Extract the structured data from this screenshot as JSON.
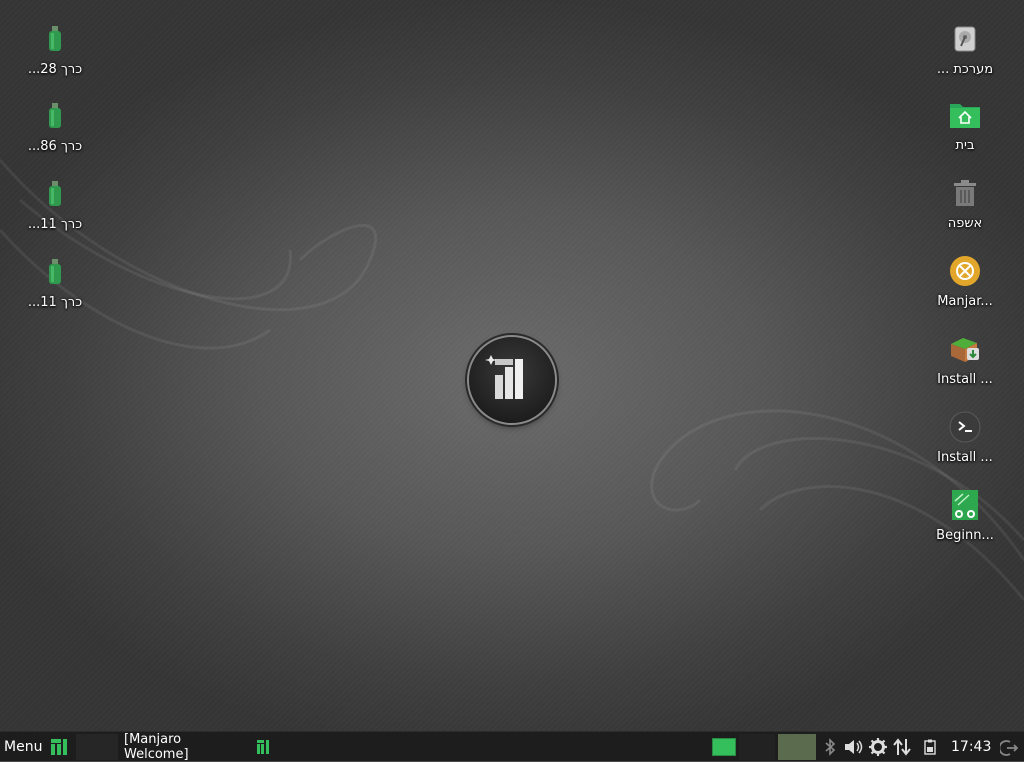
{
  "desktop": {
    "left_icons": [
      {
        "label": "כרך 28...",
        "icon": "usb-drive-icon"
      },
      {
        "label": "כרך 86...",
        "icon": "usb-drive-icon"
      },
      {
        "label": "כרך 11...",
        "icon": "usb-drive-icon"
      },
      {
        "label": "כרך 11...",
        "icon": "usb-drive-icon"
      }
    ],
    "right_icons": [
      {
        "label": "מערכת ...",
        "icon": "hard-disk-icon"
      },
      {
        "label": "בית",
        "icon": "home-folder-icon"
      },
      {
        "label": "אשפה",
        "icon": "trash-icon"
      },
      {
        "label": "Manjar...",
        "icon": "manjaro-welcome-icon"
      },
      {
        "label": "Install ...",
        "icon": "install-package-icon"
      },
      {
        "label": "Install ...",
        "icon": "terminal-icon"
      },
      {
        "label": "Beginn...",
        "icon": "beginner-guide-icon"
      }
    ]
  },
  "panel": {
    "menu_label": "Menu",
    "task_label": "[Manjaro Welcome]",
    "clock": "17:43",
    "colors": {
      "accent": "#35bf5c",
      "panel": "#1d1d1d",
      "active_workspace": "#5a6b4e"
    }
  }
}
